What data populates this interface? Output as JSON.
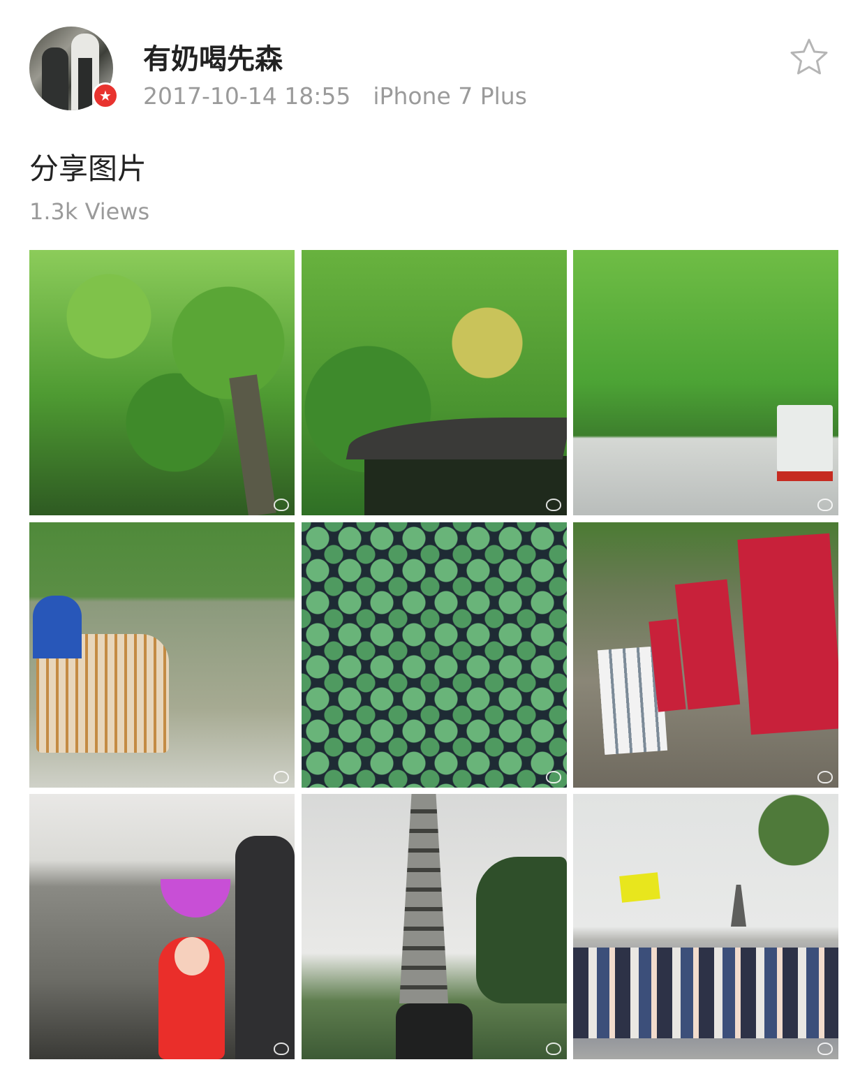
{
  "post": {
    "author": "有奶喝先森",
    "timestamp": "2017-10-14 18:55",
    "device": "iPhone 7 Plus",
    "text": "分享图片",
    "views": "1.3k Views"
  },
  "icons": {
    "favorite": "star-outline-icon",
    "verified": "verified-badge-icon",
    "watermark": "weibo-watermark-icon"
  },
  "colors": {
    "verified_badge": "#e8332f",
    "text_primary": "#222222",
    "text_secondary": "#9a9a9a"
  },
  "images": {
    "count": 9,
    "captions": [
      "",
      "",
      "",
      "",
      "",
      "",
      "",
      "",
      ""
    ]
  }
}
